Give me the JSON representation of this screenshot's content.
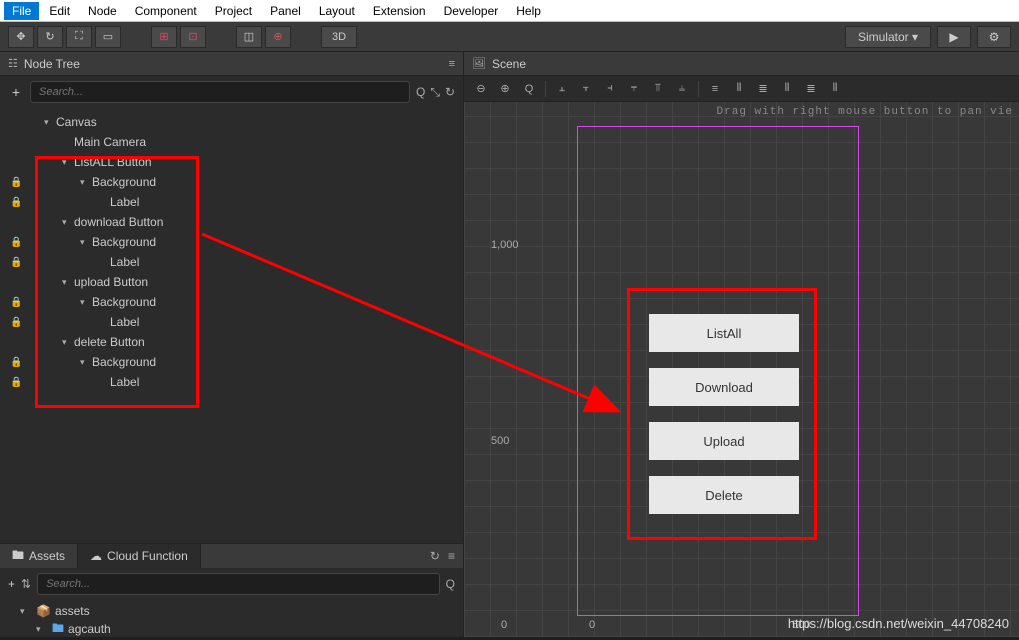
{
  "menu": {
    "items": [
      "File",
      "Edit",
      "Node",
      "Component",
      "Project",
      "Panel",
      "Layout",
      "Extension",
      "Developer",
      "Help"
    ],
    "active_index": 0
  },
  "toolbar": {
    "mode3d": "3D",
    "simulator": "Simulator ▾"
  },
  "nodeTree": {
    "title": "Node Tree",
    "search_placeholder": "Search...",
    "items": [
      {
        "name": "Canvas",
        "depth": 0,
        "arrow": true,
        "lock": false
      },
      {
        "name": "Main Camera",
        "depth": 1,
        "arrow": false,
        "lock": false
      },
      {
        "name": "ListALL Button",
        "depth": 1,
        "arrow": true,
        "lock": false
      },
      {
        "name": "Background",
        "depth": 2,
        "arrow": true,
        "lock": true
      },
      {
        "name": "Label",
        "depth": 3,
        "arrow": false,
        "lock": true
      },
      {
        "name": "download Button",
        "depth": 1,
        "arrow": true,
        "lock": false
      },
      {
        "name": "Background",
        "depth": 2,
        "arrow": true,
        "lock": true
      },
      {
        "name": "Label",
        "depth": 3,
        "arrow": false,
        "lock": true
      },
      {
        "name": "upload Button",
        "depth": 1,
        "arrow": true,
        "lock": false
      },
      {
        "name": "Background",
        "depth": 2,
        "arrow": true,
        "lock": true
      },
      {
        "name": "Label",
        "depth": 3,
        "arrow": false,
        "lock": true
      },
      {
        "name": "delete Button",
        "depth": 1,
        "arrow": true,
        "lock": false
      },
      {
        "name": "Background",
        "depth": 2,
        "arrow": true,
        "lock": true
      },
      {
        "name": "Label",
        "depth": 3,
        "arrow": false,
        "lock": true
      }
    ]
  },
  "assets": {
    "tab1": "Assets",
    "tab2": "Cloud Function",
    "search_placeholder": "Search...",
    "items": [
      {
        "name": "assets",
        "depth": 0,
        "arrow": true,
        "icon": "folder-y"
      },
      {
        "name": "agcauth",
        "depth": 1,
        "arrow": true,
        "icon": "folder-b"
      }
    ]
  },
  "scene": {
    "title": "Scene",
    "hint": "Drag with right mouse button to pan vie",
    "ruler_y": [
      "1,000",
      "500",
      "0"
    ],
    "ruler_x": [
      "0",
      "500"
    ],
    "buttons": [
      "ListAll",
      "Download",
      "Upload",
      "Delete"
    ]
  },
  "watermark": "https://blog.csdn.net/weixin_44708240"
}
